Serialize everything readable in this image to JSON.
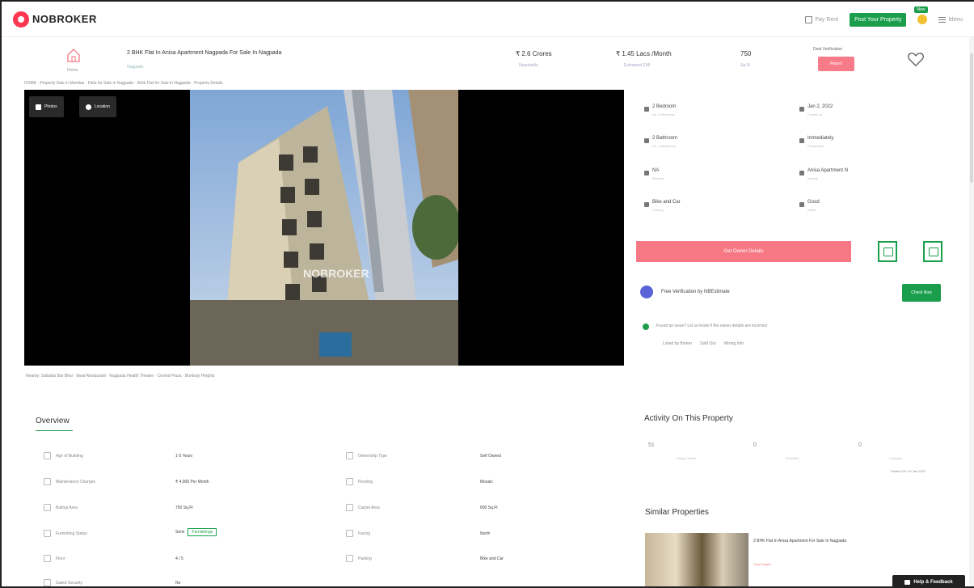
{
  "header": {
    "logo": "NOBROKER",
    "pay_rent": "Pay Rent",
    "post_property": "Post Your Property",
    "coin_badge": "New",
    "menu": "Menu"
  },
  "title_row": {
    "home_label": "Home",
    "title": "2 BHK Flat In Anisa Apartment Nagpada For Sale In Nagpada",
    "price_1": "₹ 2.6 Crores",
    "price_2": "₹ 1.45 Lacs /Month",
    "price_3": "750",
    "deal_label": "Deal Verification",
    "deal_button": "Report"
  },
  "breadcrumb": "HOME · Property Sale in Mumbai · Flats for Sale in Nagpada · 2bhk Flat for Sale in Nagpada · Property Details",
  "gallery": {
    "photos_button": "Photos",
    "location_button": "Location"
  },
  "nearby": "Nearby: Saibaba Bar Bhai · Ideal Restaurant · Nagpada Health Theatre · Central Plaza · Bombay Heights",
  "details": {
    "items": [
      {
        "label": "2 Bedroom",
        "sub": "No. of Bedroom"
      },
      {
        "label": "Jan 2, 2022",
        "sub": "Posted on"
      },
      {
        "label": "2 Bathroom",
        "sub": "No. of Bathroom"
      },
      {
        "label": "Immediately",
        "sub": "Possession"
      },
      {
        "label": "NA",
        "sub": "Balcony"
      },
      {
        "label": "Anisa Apartment N",
        "sub": "Society"
      },
      {
        "label": "Bike and Car",
        "sub": "Parking"
      },
      {
        "label": "Good",
        "sub": "Water"
      }
    ],
    "contact_button": "Get Owner Details"
  },
  "free_legal": "Free Verification by NBEstimate",
  "check_now": "Check Now",
  "found_text": "Found an issue? Let us know if the owner details are incorrect",
  "found_options": [
    "Listed by Broker",
    "Sold Out",
    "Wrong Info"
  ],
  "overview": {
    "title": "Overview",
    "rows": [
      {
        "label": "Age of Building",
        "value": "1-5 Years"
      },
      {
        "label": "Ownership Type",
        "value": "Self Owned"
      },
      {
        "label": "Maintenance Charges",
        "value": "₹ 4,000 Per Month"
      },
      {
        "label": "Flooring",
        "value": "Mosaic"
      },
      {
        "label": "Builtup Area",
        "value": "750 Sq.Ft"
      },
      {
        "label": "Carpet Area",
        "value": "600 Sq.Ft"
      },
      {
        "label": "Furnishing Status",
        "value": "Semi"
      },
      {
        "label": "Facing",
        "value": "North"
      },
      {
        "label": "Floor",
        "value": "4 / 5"
      },
      {
        "label": "Parking",
        "value": "Bike and Car"
      },
      {
        "label": "Gated Security",
        "value": "No"
      }
    ],
    "furnishing_tag": "Furnishings"
  },
  "activity": {
    "title": "Activity On This Property",
    "views": "51",
    "views_sub": "Unique Views",
    "shortlists": "0",
    "shortlists_sub": "Shortlists",
    "contacts": "0",
    "contacts_sub": "Contacts",
    "note": "Posted On: 09 Jan 2022"
  },
  "similar": {
    "title": "Similar Properties",
    "item_title": "2 BHK Flat In Anisa Apartment For Sale In Nagpada",
    "item_sub": "View Details"
  },
  "help": "Help & Feedback"
}
